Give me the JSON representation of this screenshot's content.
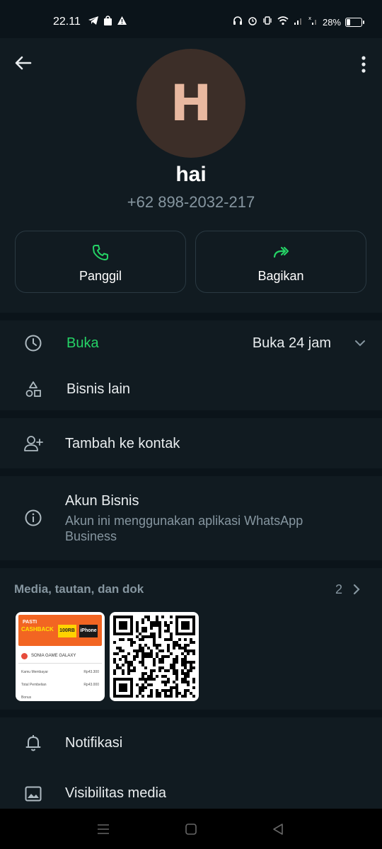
{
  "status_bar": {
    "time": "22.11",
    "battery": "28%",
    "left_icons": [
      "telegram-icon",
      "shopee-icon",
      "warning-icon"
    ],
    "right_icons": [
      "headphones-icon",
      "alarm-icon",
      "vibrate-icon",
      "wifi-icon",
      "signal-icon",
      "signal-off-icon"
    ],
    "battery_level": 0.28
  },
  "contact": {
    "avatar_letter": "H",
    "name": "hai",
    "phone": "+62 898-2032-217"
  },
  "actions": {
    "call_label": "Panggil",
    "share_label": "Bagikan"
  },
  "business_hours": {
    "status": "Buka",
    "value": "Buka 24 jam"
  },
  "other_business": {
    "label": "Bisnis lain"
  },
  "add_contact": {
    "label": "Tambah ke kontak"
  },
  "business_account": {
    "title": "Akun Bisnis",
    "subtitle": "Akun ini menggunakan aplikasi WhatsApp Business"
  },
  "media": {
    "title": "Media, tautan, dan dok",
    "count": "2",
    "thumb1": {
      "banner_line1": "PASTI",
      "banner_line2": "CASHBACK",
      "promo1": "100RB",
      "promo2": "iPhone",
      "store": "SONIA GAME GALAXY",
      "row1_label": "Kamu Membayar",
      "row1_value": "Rp43.300",
      "row2_label": "Total Pembelian",
      "row2_value": "Rp43.000",
      "footer": "Bonus"
    }
  },
  "settings": {
    "notifications": "Notifikasi",
    "media_visibility": "Visibilitas media"
  },
  "colors": {
    "background": "#0b141a",
    "surface": "#111b21",
    "accent_green": "#25d366",
    "secondary_text": "#8696a0"
  }
}
